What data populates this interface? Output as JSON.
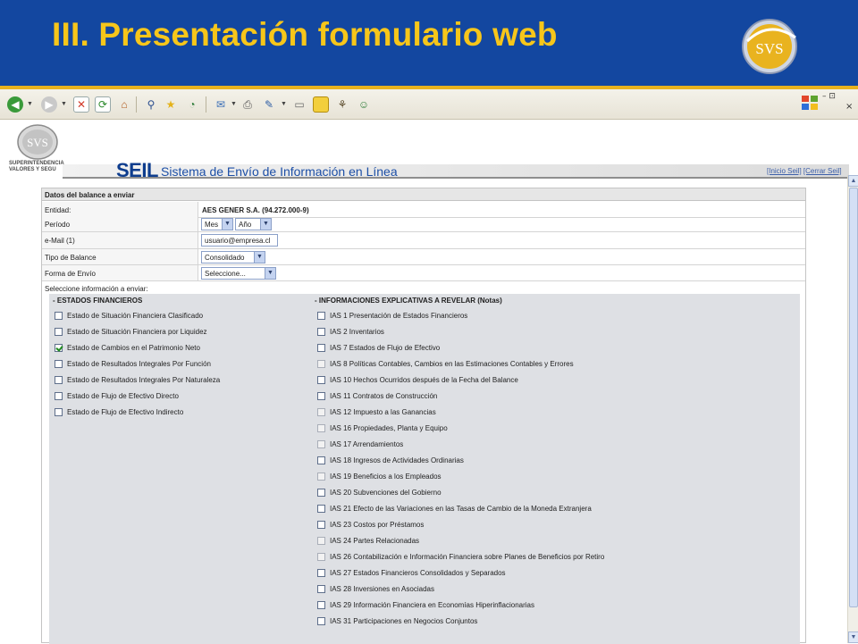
{
  "slide": {
    "title": "III. Presentación formulario web",
    "logo_text": "SVS",
    "colors": {
      "header_bg": "#1347a0",
      "title": "#f7c61a",
      "divider": "#e8b21e"
    }
  },
  "browser": {
    "toolbar_icons": [
      "back-icon",
      "forward-icon",
      "stop-icon",
      "refresh-icon",
      "home-icon",
      "search-icon",
      "favorites-icon",
      "history-icon",
      "mail-icon",
      "print-icon",
      "edit-icon",
      "discuss-icon",
      "folder-icon",
      "research-icon",
      "messenger-icon"
    ],
    "window_controls": "–  ⊡",
    "window_close": "×"
  },
  "site": {
    "logo_text": "SVS",
    "org_line1": "SUPERINTENDENCIA",
    "org_line2": "VALORES Y SEGU",
    "seil": "SEIL",
    "seil_full": "Sistema de Envío de Información en Línea",
    "link_inicio": "[Inicio Seil]",
    "link_cerrar": "[Cerrar Seil]"
  },
  "form": {
    "title": "Datos del balance a enviar",
    "entidad_label": "Entidad:",
    "entidad_value": "AES GENER S.A. (94.272.000-9)",
    "periodo_label": "Período",
    "mes": "Mes",
    "anio": "Año",
    "email_label": "e-Mail (1)",
    "email_value": "usuario@empresa.cl",
    "tipo_label": "Tipo de Balance",
    "tipo_value": "Consolidado",
    "forma_label": "Forma de Envío",
    "forma_value": "Seleccione...",
    "select_info": "Seleccione información a enviar:",
    "left_header": "- ESTADOS FINANCIEROS",
    "right_header": "- INFORMACIONES EXPLICATIVAS A REVELAR (Notas)",
    "estados": [
      {
        "label": "Estado de Situación Financiera Clasificado",
        "checked": false
      },
      {
        "label": "Estado de Situación Financiera por Liquidez",
        "checked": false
      },
      {
        "label": "Estado de Cambios en el Patrimonio Neto",
        "checked": true
      },
      {
        "label": "Estado de Resultados Integrales Por Función",
        "checked": false
      },
      {
        "label": "Estado de Resultados Integrales Por Naturaleza",
        "checked": false
      },
      {
        "label": "Estado de Flujo de Efectivo Directo",
        "checked": false
      },
      {
        "label": "Estado de Flujo de Efectivo Indirecto",
        "checked": false
      }
    ],
    "notas": [
      {
        "label": "IAS 1 Presentación de Estados Financieros",
        "enabled": true
      },
      {
        "label": "IAS 2 Inventarios",
        "enabled": true
      },
      {
        "label": "IAS 7 Estados de Flujo de Efectivo",
        "enabled": true
      },
      {
        "label": "IAS 8 Políticas Contables, Cambios en las Estimaciones Contables y Errores",
        "enabled": false
      },
      {
        "label": "IAS 10 Hechos Ocurridos después de la Fecha del Balance",
        "enabled": true
      },
      {
        "label": "IAS 11 Contratos de Construcción",
        "enabled": true
      },
      {
        "label": "IAS 12 Impuesto a las Ganancias",
        "enabled": false
      },
      {
        "label": "IAS 16 Propiedades, Planta y Equipo",
        "enabled": false
      },
      {
        "label": "IAS 17 Arrendamientos",
        "enabled": false
      },
      {
        "label": "IAS 18 Ingresos de Actividades Ordinarias",
        "enabled": true
      },
      {
        "label": "IAS 19 Beneficios a los Empleados",
        "enabled": false
      },
      {
        "label": "IAS 20 Subvenciones del Gobierno",
        "enabled": true
      },
      {
        "label": "IAS 21 Efecto de las Variaciones en las Tasas de Cambio de la Moneda Extranjera",
        "enabled": true
      },
      {
        "label": "IAS 23 Costos por Préstamos",
        "enabled": true
      },
      {
        "label": "IAS 24 Partes Relacionadas",
        "enabled": false
      },
      {
        "label": "IAS 26 Contabilización e Información Financiera sobre Planes de Beneficios por Retiro",
        "enabled": false
      },
      {
        "label": "IAS 27 Estados Financieros Consolidados y Separados",
        "enabled": true
      },
      {
        "label": "IAS 28 Inversiones en Asociadas",
        "enabled": true
      },
      {
        "label": "IAS 29 Información Financiera en Economías Hiperinflacionarias",
        "enabled": true
      },
      {
        "label": "IAS 31 Participaciones en Negocios Conjuntos",
        "enabled": true
      }
    ]
  }
}
